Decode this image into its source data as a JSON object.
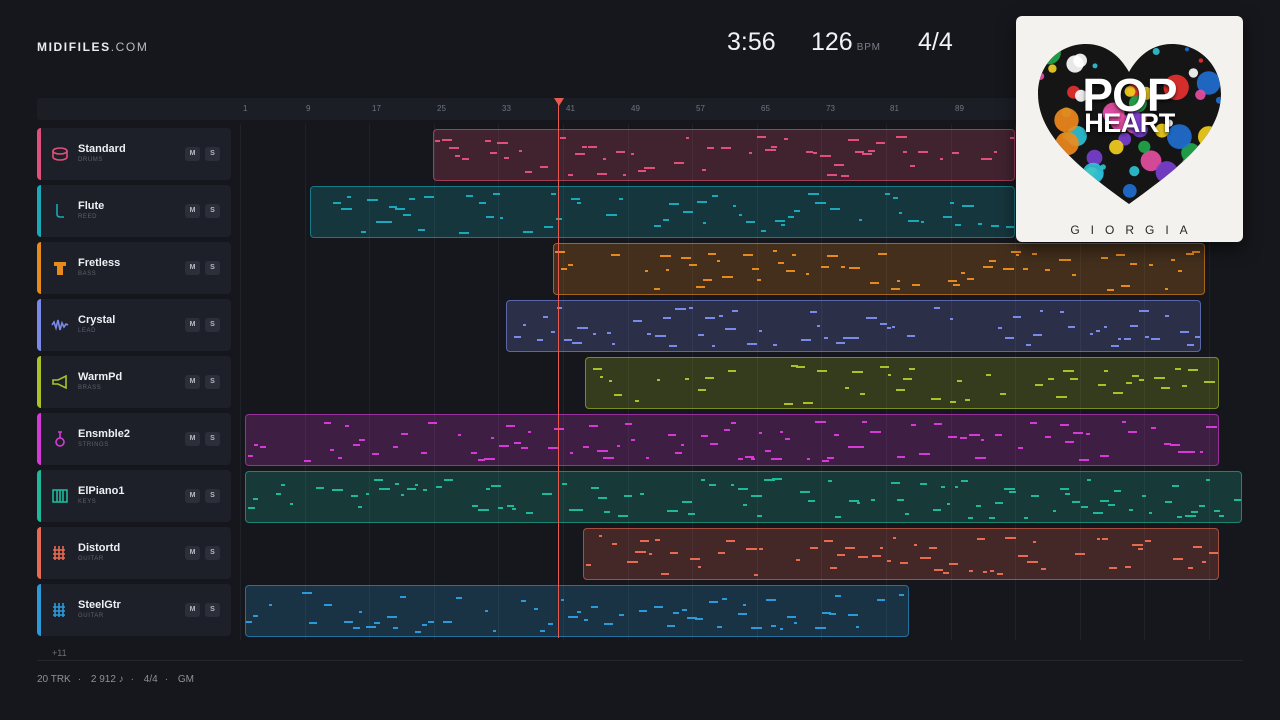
{
  "brand": {
    "name": "MIDIFILES",
    "domain": ".COM"
  },
  "stats": {
    "time": "3:56",
    "bpm": "126",
    "bpm_unit": "BPM",
    "signature": "4/4"
  },
  "ruler": {
    "ticks": [
      "1",
      "9",
      "17",
      "25",
      "33",
      "41",
      "49",
      "57",
      "65",
      "73",
      "81",
      "89"
    ]
  },
  "tracks": [
    {
      "name": "Standard",
      "category": "DRUMS",
      "color": "#e0507a",
      "icon": "drum-icon",
      "mute": "M",
      "solo": "S"
    },
    {
      "name": "Flute",
      "category": "REED",
      "color": "#1ba8b8",
      "icon": "flute-icon",
      "mute": "M",
      "solo": "S"
    },
    {
      "name": "Fretless",
      "category": "BASS",
      "color": "#e68a1e",
      "icon": "bass-amp-icon",
      "mute": "M",
      "solo": "S"
    },
    {
      "name": "Crystal",
      "category": "LEAD",
      "color": "#7a8ae8",
      "icon": "waveform-icon",
      "mute": "M",
      "solo": "S"
    },
    {
      "name": "WarmPd",
      "category": "BRASS",
      "color": "#a9c22a",
      "icon": "horn-icon",
      "mute": "M",
      "solo": "S"
    },
    {
      "name": "Ensmble2",
      "category": "STRINGS",
      "color": "#d63ad6",
      "icon": "violin-icon",
      "mute": "M",
      "solo": "S"
    },
    {
      "name": "ElPiano1",
      "category": "KEYS",
      "color": "#1fb89a",
      "icon": "piano-icon",
      "mute": "M",
      "solo": "S"
    },
    {
      "name": "Distortd",
      "category": "GUITAR",
      "color": "#e86a50",
      "icon": "fretboard-icon",
      "mute": "M",
      "solo": "S"
    },
    {
      "name": "SteelGtr",
      "category": "GUITAR",
      "color": "#2c9ad8",
      "icon": "fretboard-icon",
      "mute": "M",
      "solo": "S"
    }
  ],
  "more_tracks": "+11",
  "footer": {
    "tracks": "20 TRK",
    "notes": "2 912 ♪",
    "signature": "4/4",
    "standard": "GM"
  },
  "album": {
    "title_line1": "POP",
    "title_line2": "HEART",
    "artist": "GIORGIA"
  }
}
